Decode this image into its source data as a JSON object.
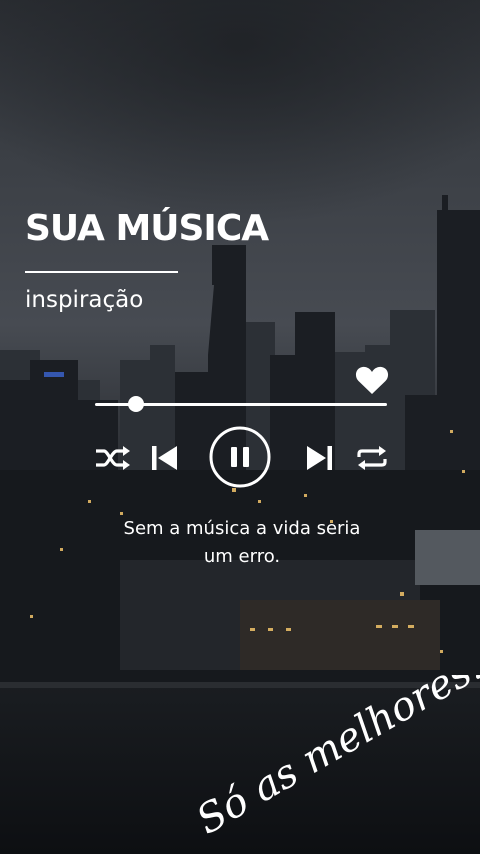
{
  "card": {
    "title": "SUA MÚSICA",
    "subtitle": "inspiração",
    "quote_line1": "Sem a música a vida seria",
    "quote_line2": "um erro.",
    "signature": "Só as melhores!"
  },
  "player": {
    "progress": 0.14,
    "icons": [
      "heart-icon",
      "shuffle-icon",
      "previous-icon",
      "pause-icon",
      "next-icon",
      "repeat-icon"
    ]
  },
  "colors": {
    "foreground": "#ffffff",
    "sky": "#3a3e45",
    "city_dark": "#14171b",
    "window_light": "#f2c46b"
  }
}
